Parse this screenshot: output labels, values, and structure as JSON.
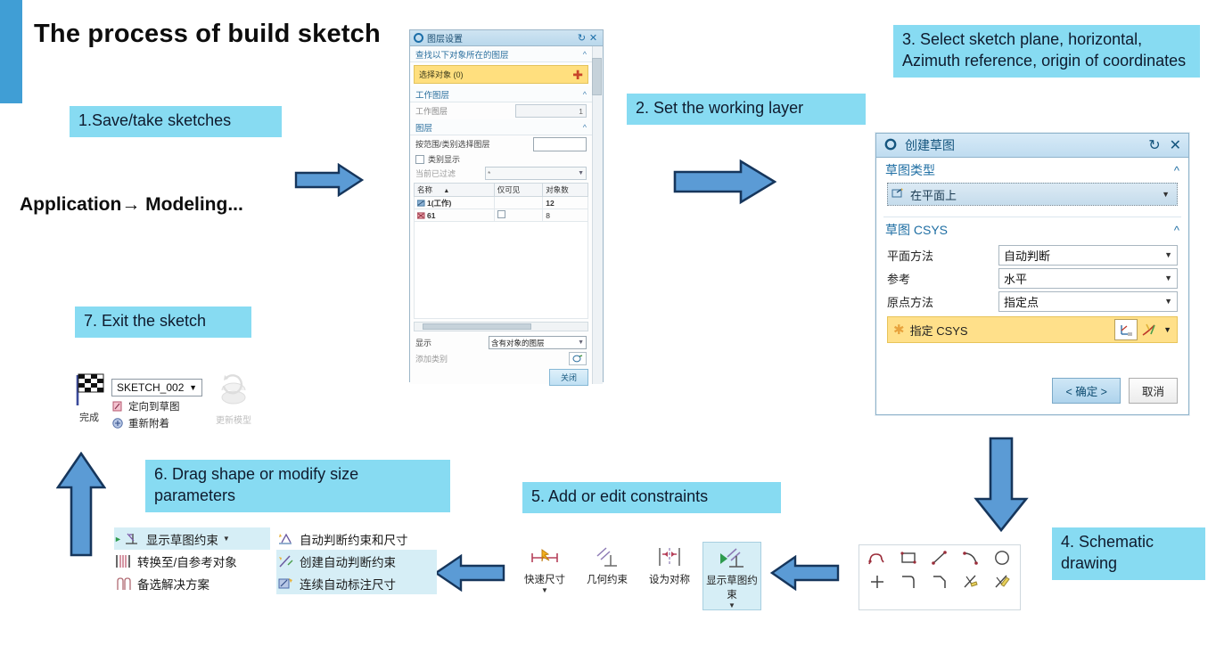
{
  "title": "The process of build sketch",
  "app_path": "Application→ Modeling...",
  "callouts": {
    "c1": "1.Save/take sketches",
    "c2": "2. Set the working layer",
    "c3": "3. Select sketch plane, horizontal, Azimuth reference, origin of coordinates",
    "c4": "4. Schematic drawing",
    "c5": "5. Add or edit constraints",
    "c6": "6. Drag shape or modify size parameters",
    "c7": "7. Exit the sketch"
  },
  "layer_dialog": {
    "title": "图层设置",
    "reset_icon": "reset-icon",
    "close_icon": "close-icon",
    "section_select": "查找以下对象所在的图层",
    "select_object": "选择对象 (0)",
    "section_work": "工作图层",
    "work_layer_label": "工作图层",
    "work_layer_value": "1",
    "section_layer": "图层",
    "range_label": "按范围/类别选择图层",
    "range_value": "",
    "category_checkbox": "类别显示",
    "filter_label": "当前已过滤",
    "filter_value": "*",
    "columns": [
      "名称",
      "仅可见",
      "对象数"
    ],
    "rows": [
      {
        "name": "1(工作)",
        "visible": "",
        "count": "12"
      },
      {
        "name": "61",
        "visible": "",
        "count": "8"
      }
    ],
    "display_label": "显示",
    "display_value": "含有对象的图层",
    "add_category_label": "添加类别",
    "close_button": "关闭"
  },
  "sketch_dialog": {
    "title": "创建草图",
    "reset_icon": "reset-icon",
    "close_icon": "close-icon",
    "section_type": "草图类型",
    "type_value": "在平面上",
    "section_csys": "草图 CSYS",
    "fields": [
      {
        "label": "平面方法",
        "value": "自动判断"
      },
      {
        "label": "参考",
        "value": "水平"
      },
      {
        "label": "原点方法",
        "value": "指定点"
      }
    ],
    "specify_csys": "指定 CSYS",
    "ok_button": "< 确定 >",
    "cancel_button": "取消"
  },
  "finish_group": {
    "finish_label": "完成",
    "sketch_name": "SKETCH_002",
    "orient_label": "定向到草图",
    "reattach_label": "重新附着",
    "update_label": "更新模型"
  },
  "constraint_panel_left": [
    {
      "label": "显示草图约束",
      "highlight": true,
      "has_arrow": true
    },
    {
      "label": "转换至/自参考对象",
      "highlight": false,
      "has_arrow": false
    },
    {
      "label": "备选解决方案",
      "highlight": false,
      "has_arrow": false
    }
  ],
  "constraint_panel_right": [
    {
      "label": "自动判断约束和尺寸",
      "highlight": false
    },
    {
      "label": "创建自动判断约束",
      "highlight": true
    },
    {
      "label": "连续自动标注尺寸",
      "highlight": true
    }
  ],
  "constraint_toolbar": [
    {
      "label": "快速尺寸",
      "icon": "quick-dimension-icon",
      "highlight": false,
      "has_dropdown": true
    },
    {
      "label": "几何约束",
      "icon": "geometric-constraint-icon",
      "highlight": false,
      "has_dropdown": false
    },
    {
      "label": "设为对称",
      "icon": "make-symmetric-icon",
      "highlight": false,
      "has_dropdown": false
    },
    {
      "label": "显示草图约束",
      "icon": "show-sketch-constraints-icon",
      "highlight": true,
      "has_dropdown": true
    }
  ],
  "sketch_tools": [
    "profile-icon",
    "rectangle-icon",
    "line-icon",
    "arc-icon",
    "circle-icon",
    "point-icon",
    "fillet-icon",
    "chamfer-icon",
    "trim-icon",
    "extend-icon"
  ],
  "colors": {
    "accent_bar": "#409ed5",
    "callout_bg": "#87dbf2",
    "arrow_fill": "#5b9bd5",
    "arrow_stroke": "#16365c",
    "yellow_field": "#ffe08a"
  }
}
